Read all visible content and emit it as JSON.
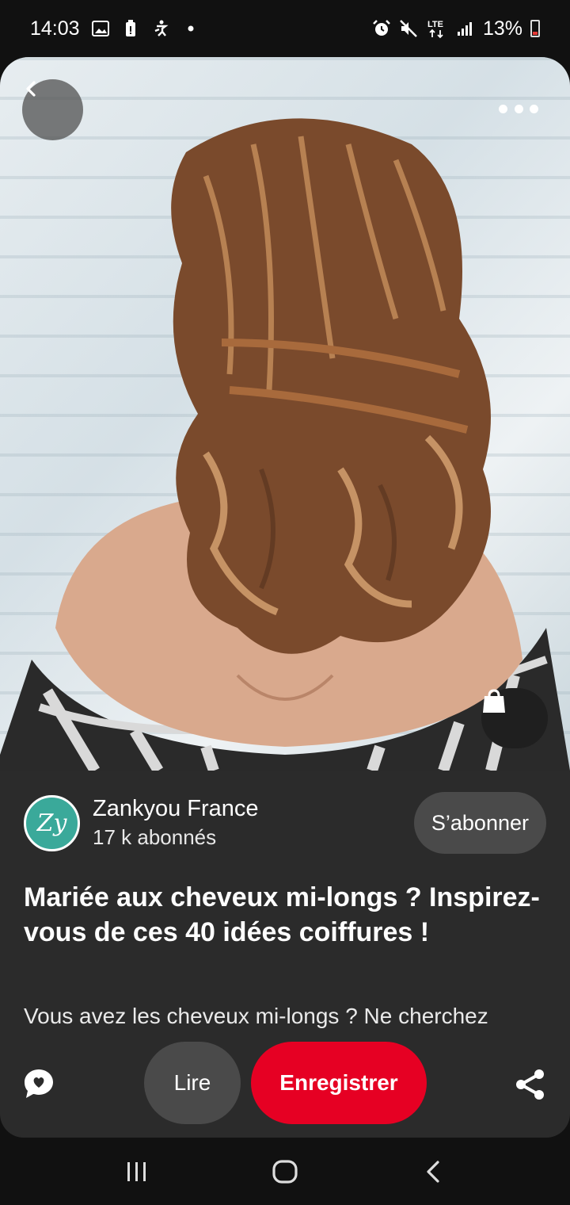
{
  "status_bar": {
    "time": "14:03",
    "network": "LTE",
    "battery": "13%",
    "icons": [
      "gallery-icon",
      "battery-saver-icon",
      "accessibility-icon",
      "dot-icon",
      "alarm-icon",
      "mute-icon",
      "lte-icon",
      "signal-icon",
      "battery-icon"
    ]
  },
  "pin": {
    "image_alt": "",
    "menu_icon": "more-icon",
    "back_icon": "back-icon",
    "shop_icon": "shopping-bag-icon"
  },
  "creator": {
    "avatar_text": "Zy",
    "name": "Zankyou France",
    "followers": "17 k abonnés",
    "follow_label": "S’abonner"
  },
  "content": {
    "title": "Mariée aux cheveux mi-longs ? Inspirez-vous de ces 40 idées coiffures !",
    "description": "Vous avez les cheveux mi-longs ? Ne cherchez"
  },
  "actions": {
    "read_label": "Lire",
    "save_label": "Enregistrer",
    "comment_icon": "comment-icon",
    "share_icon": "share-icon"
  },
  "colors": {
    "accent": "#e60023",
    "card_bg": "#2b2b2b",
    "button_bg": "#4a4a4a",
    "avatar_bg": "#3aa99a"
  },
  "navbar": {
    "icons": [
      "recents-icon",
      "home-icon",
      "back-nav-icon"
    ]
  }
}
